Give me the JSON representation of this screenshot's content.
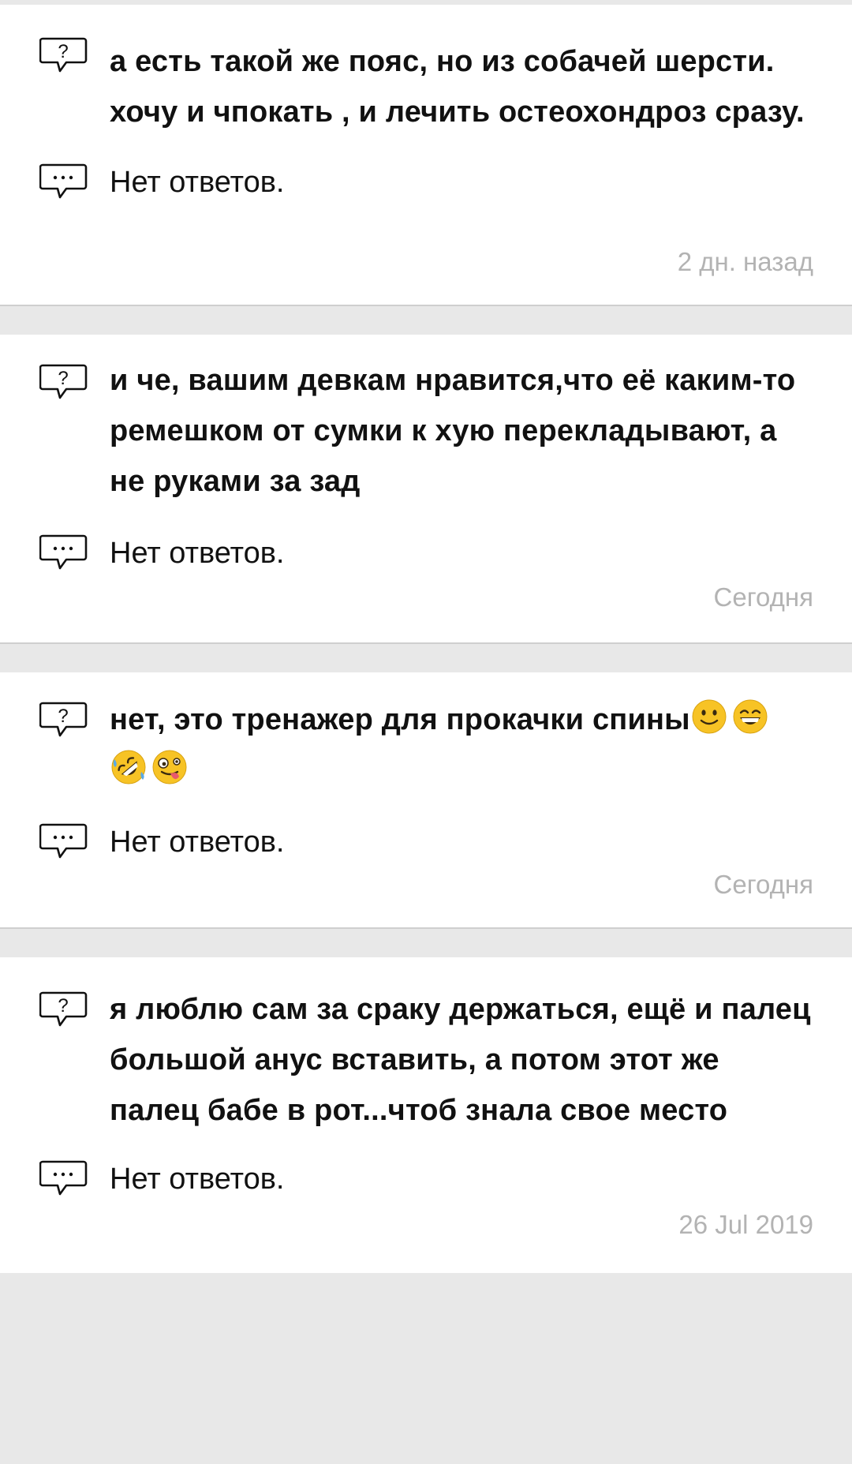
{
  "colors": {
    "background": "#e8e8e8",
    "card": "#ffffff",
    "text": "#111111",
    "timestamp": "#b3b3b3",
    "emoji_yellow": "#f7c325"
  },
  "cards": [
    {
      "question_icon": "question-bubble-icon",
      "question": "а есть такой же пояс, но из собачей шерсти. хочу и чпокать , и лечить остеохондроз сразу.",
      "answer_icon": "comment-bubble-icon",
      "answer": "Нет ответов.",
      "time": "2 дн. назад"
    },
    {
      "question_icon": "question-bubble-icon",
      "question": "и че, вашим девкам нравится,что её каким-то ремешком от сумки к хую перекладывают, а не руками за зад",
      "answer_icon": "comment-bubble-icon",
      "answer": "Нет ответов.",
      "time": "Сегодня"
    },
    {
      "question_icon": "question-bubble-icon",
      "question": "нет, это тренажер для прокачки спины",
      "question_emojis": [
        "slightly-smiling-face-emoji",
        "grinning-squinting-face-emoji",
        "rolling-on-floor-laughing-emoji",
        "zany-face-emoji"
      ],
      "answer_icon": "comment-bubble-icon",
      "answer": "Нет ответов.",
      "time": "Сегодня"
    },
    {
      "question_icon": "question-bubble-icon",
      "question": "я люблю сам за сраку держаться, ещё и палец большой анус вставить, а потом этот же палец бабе в рот...чтоб знала свое место",
      "answer_icon": "comment-bubble-icon",
      "answer": "Нет ответов.",
      "time": "26 Jul 2019"
    }
  ]
}
